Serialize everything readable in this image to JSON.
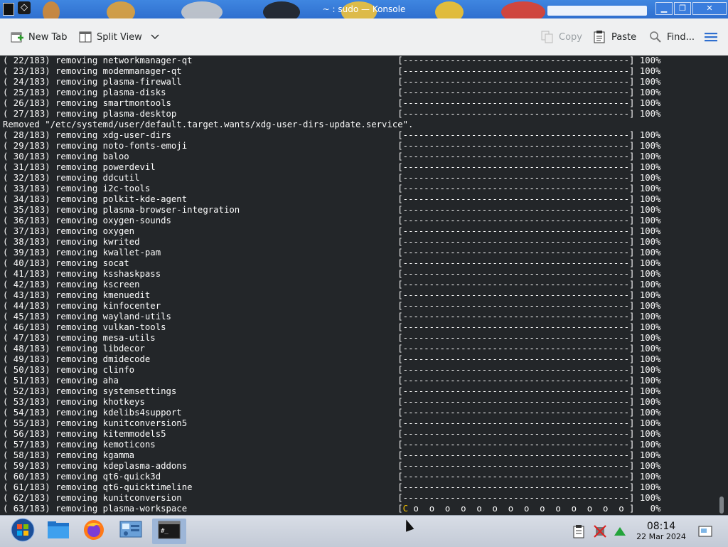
{
  "window": {
    "title": "~ : sudo — Konsole"
  },
  "toolbar": {
    "new_tab": "New Tab",
    "split_view": "Split View",
    "copy": "Copy",
    "paste": "Paste",
    "find": "Find..."
  },
  "terminal": {
    "lines": [
      {
        "type": "progress",
        "counter": "( 22/183)",
        "text": "removing networkmanager-qt",
        "percent": "100%"
      },
      {
        "type": "progress",
        "counter": "( 23/183)",
        "text": "removing modemmanager-qt",
        "percent": "100%"
      },
      {
        "type": "progress",
        "counter": "( 24/183)",
        "text": "removing plasma-firewall",
        "percent": "100%"
      },
      {
        "type": "progress",
        "counter": "( 25/183)",
        "text": "removing plasma-disks",
        "percent": "100%"
      },
      {
        "type": "progress",
        "counter": "( 26/183)",
        "text": "removing smartmontools",
        "percent": "100%"
      },
      {
        "type": "progress",
        "counter": "( 27/183)",
        "text": "removing plasma-desktop",
        "percent": "100%"
      },
      {
        "type": "message",
        "text": "Removed \"/etc/systemd/user/default.target.wants/xdg-user-dirs-update.service\"."
      },
      {
        "type": "progress",
        "counter": "( 28/183)",
        "text": "removing xdg-user-dirs",
        "percent": "100%"
      },
      {
        "type": "progress",
        "counter": "( 29/183)",
        "text": "removing noto-fonts-emoji",
        "percent": "100%"
      },
      {
        "type": "progress",
        "counter": "( 30/183)",
        "text": "removing baloo",
        "percent": "100%"
      },
      {
        "type": "progress",
        "counter": "( 31/183)",
        "text": "removing powerdevil",
        "percent": "100%"
      },
      {
        "type": "progress",
        "counter": "( 32/183)",
        "text": "removing ddcutil",
        "percent": "100%"
      },
      {
        "type": "progress",
        "counter": "( 33/183)",
        "text": "removing i2c-tools",
        "percent": "100%"
      },
      {
        "type": "progress",
        "counter": "( 34/183)",
        "text": "removing polkit-kde-agent",
        "percent": "100%"
      },
      {
        "type": "progress",
        "counter": "( 35/183)",
        "text": "removing plasma-browser-integration",
        "percent": "100%"
      },
      {
        "type": "progress",
        "counter": "( 36/183)",
        "text": "removing oxygen-sounds",
        "percent": "100%"
      },
      {
        "type": "progress",
        "counter": "( 37/183)",
        "text": "removing oxygen",
        "percent": "100%"
      },
      {
        "type": "progress",
        "counter": "( 38/183)",
        "text": "removing kwrited",
        "percent": "100%"
      },
      {
        "type": "progress",
        "counter": "( 39/183)",
        "text": "removing kwallet-pam",
        "percent": "100%"
      },
      {
        "type": "progress",
        "counter": "( 40/183)",
        "text": "removing socat",
        "percent": "100%"
      },
      {
        "type": "progress",
        "counter": "( 41/183)",
        "text": "removing ksshaskpass",
        "percent": "100%"
      },
      {
        "type": "progress",
        "counter": "( 42/183)",
        "text": "removing kscreen",
        "percent": "100%"
      },
      {
        "type": "progress",
        "counter": "( 43/183)",
        "text": "removing kmenuedit",
        "percent": "100%"
      },
      {
        "type": "progress",
        "counter": "( 44/183)",
        "text": "removing kinfocenter",
        "percent": "100%"
      },
      {
        "type": "progress",
        "counter": "( 45/183)",
        "text": "removing wayland-utils",
        "percent": "100%"
      },
      {
        "type": "progress",
        "counter": "( 46/183)",
        "text": "removing vulkan-tools",
        "percent": "100%"
      },
      {
        "type": "progress",
        "counter": "( 47/183)",
        "text": "removing mesa-utils",
        "percent": "100%"
      },
      {
        "type": "progress",
        "counter": "( 48/183)",
        "text": "removing libdecor",
        "percent": "100%"
      },
      {
        "type": "progress",
        "counter": "( 49/183)",
        "text": "removing dmidecode",
        "percent": "100%"
      },
      {
        "type": "progress",
        "counter": "( 50/183)",
        "text": "removing clinfo",
        "percent": "100%"
      },
      {
        "type": "progress",
        "counter": "( 51/183)",
        "text": "removing aha",
        "percent": "100%"
      },
      {
        "type": "progress",
        "counter": "( 52/183)",
        "text": "removing systemsettings",
        "percent": "100%"
      },
      {
        "type": "progress",
        "counter": "( 53/183)",
        "text": "removing khotkeys",
        "percent": "100%"
      },
      {
        "type": "progress",
        "counter": "( 54/183)",
        "text": "removing kdelibs4support",
        "percent": "100%"
      },
      {
        "type": "progress",
        "counter": "( 55/183)",
        "text": "removing kunitconversion5",
        "percent": "100%"
      },
      {
        "type": "progress",
        "counter": "( 56/183)",
        "text": "removing kitemmodels5",
        "percent": "100%"
      },
      {
        "type": "progress",
        "counter": "( 57/183)",
        "text": "removing kemoticons",
        "percent": "100%"
      },
      {
        "type": "progress",
        "counter": "( 58/183)",
        "text": "removing kgamma",
        "percent": "100%"
      },
      {
        "type": "progress",
        "counter": "( 59/183)",
        "text": "removing kdeplasma-addons",
        "percent": "100%"
      },
      {
        "type": "progress",
        "counter": "( 60/183)",
        "text": "removing qt6-quick3d",
        "percent": "100%"
      },
      {
        "type": "progress",
        "counter": "( 61/183)",
        "text": "removing qt6-quicktimeline",
        "percent": "100%"
      },
      {
        "type": "progress",
        "counter": "( 62/183)",
        "text": "removing kunitconversion",
        "percent": "100%"
      },
      {
        "type": "active",
        "counter": "( 63/183)",
        "text": "removing plasma-workspace",
        "percent": "0%"
      }
    ]
  },
  "taskbar": {
    "items": [
      "start-menu",
      "file-manager",
      "firefox",
      "system-settings",
      "konsole"
    ],
    "clock_time": "08:14",
    "clock_date": "22 Mar 2024"
  },
  "colors": {
    "terminal_bg": "#232629",
    "terminal_fg": "#fcfcfc",
    "titlebar": "#3079d6",
    "pacman_cursor": "#e8b400"
  }
}
